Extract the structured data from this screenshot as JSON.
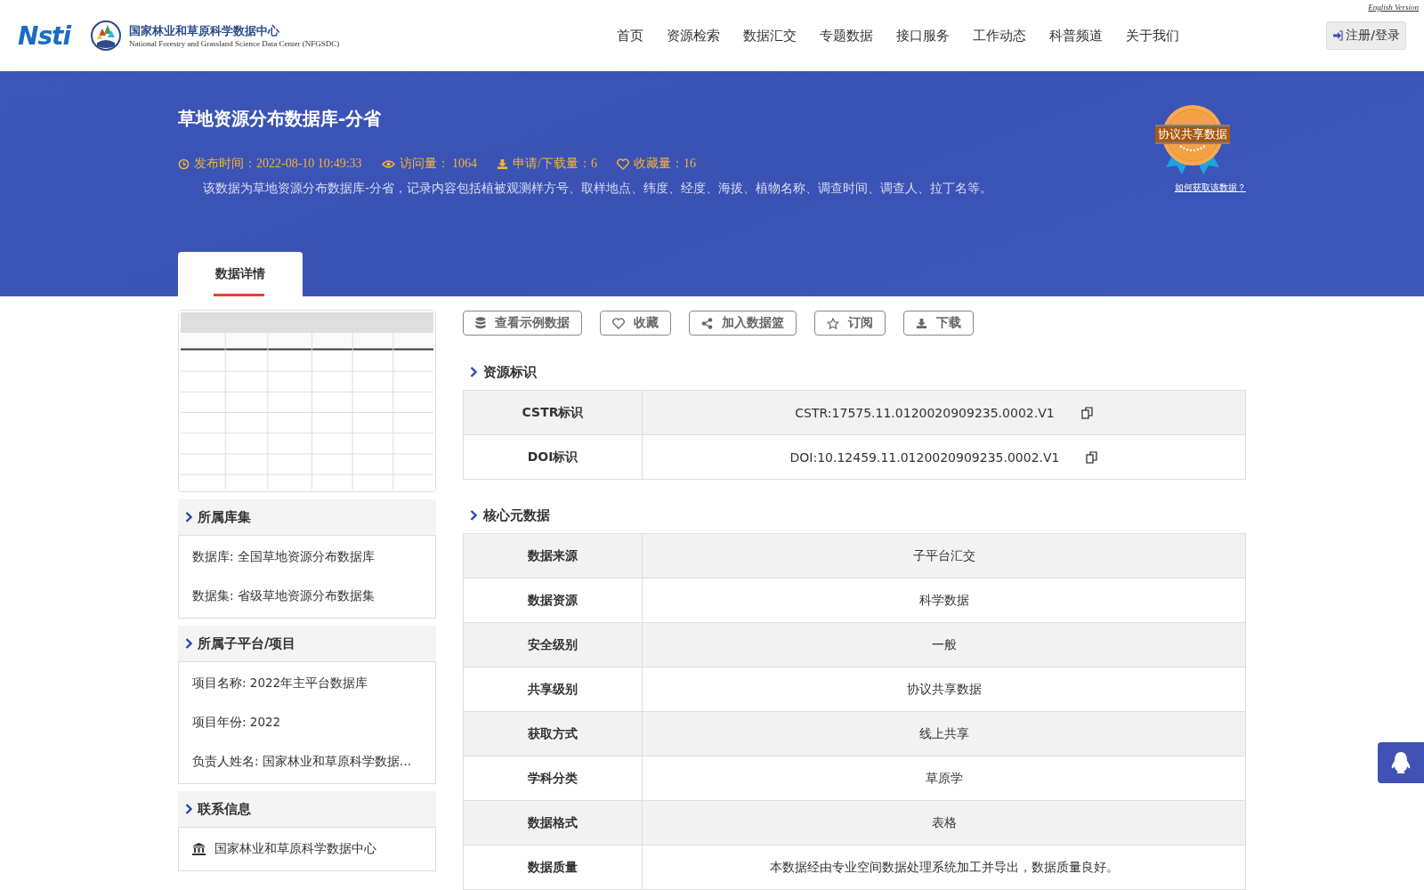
{
  "header": {
    "english_link": "English Version",
    "logo_mark": "Nsti",
    "logo_name": "国家林业和草原科学数据中心",
    "logo_subtitle": "National Forestry and Grassland Science Data Center (NFGSDC)",
    "nav": [
      {
        "label": "首页"
      },
      {
        "label": "资源检索"
      },
      {
        "label": "数据汇交"
      },
      {
        "label": "专题数据"
      },
      {
        "label": "接口服务"
      },
      {
        "label": "工作动态"
      },
      {
        "label": "科普频道"
      },
      {
        "label": "关于我们"
      }
    ],
    "login": "注册/登录"
  },
  "dataset": {
    "title": "草地资源分布数据库-分省",
    "meta": [
      {
        "kind": "time",
        "text": "发布时间：2022-08-10 10:49:33"
      },
      {
        "kind": "views",
        "text": "访问量： 1064"
      },
      {
        "kind": "downloads",
        "text": "申请/下载量：6"
      },
      {
        "kind": "favorites",
        "text": "收藏量：16"
      }
    ],
    "description": "该数据为草地资源分布数据库-分省，记录内容包括植被观测样方号、取样地点、纬度、经度、海拔、植物名称、调查时间、调查人、拉丁名等。",
    "badge": "协议共享数据",
    "badge_link": "如何获取该数据？"
  },
  "tabs": [
    {
      "label": "数据详情",
      "selected": true
    }
  ],
  "side_panels": [
    {
      "title": "所属库集",
      "items": [
        {
          "kind": "text",
          "text": "数据库: 全国草地资源分布数据库"
        },
        {
          "kind": "text",
          "text": "数据集: 省级草地资源分布数据集"
        }
      ]
    },
    {
      "title": "所属子平台/项目",
      "items": [
        {
          "kind": "text",
          "text": "项目名称: 2022年主平台数据库"
        },
        {
          "kind": "text",
          "text": "项目年份: 2022"
        },
        {
          "kind": "text",
          "text": "负责人姓名: 国家林业和草原科学数据…"
        }
      ]
    },
    {
      "title": "联系信息",
      "items": [
        {
          "kind": "org",
          "text": "国家林业和草原科学数据中心"
        }
      ]
    }
  ],
  "actions": [
    {
      "kind": "sample",
      "label": "查看示例数据"
    },
    {
      "kind": "favorite",
      "label": "收藏"
    },
    {
      "kind": "basket",
      "label": "加入数据篮"
    },
    {
      "kind": "subscribe",
      "label": "订阅"
    },
    {
      "kind": "download",
      "label": "下载"
    }
  ],
  "sections": [
    {
      "title": "资源标识",
      "rows": [
        {
          "label": "CSTR标识",
          "value": "CSTR:17575.11.0120020909235.0002.V1",
          "copyable": true
        },
        {
          "label": "DOI标识",
          "value": "DOI:10.12459.11.0120020909235.0002.V1",
          "copyable": true
        }
      ]
    },
    {
      "title": "核心元数据",
      "rows": [
        {
          "label": "数据来源",
          "value": "子平台汇交",
          "copyable": false
        },
        {
          "label": "数据资源",
          "value": "科学数据",
          "copyable": false
        },
        {
          "label": "安全级别",
          "value": "一般",
          "copyable": false
        },
        {
          "label": "共享级别",
          "value": "协议共享数据",
          "copyable": false
        },
        {
          "label": "获取方式",
          "value": "线上共享",
          "copyable": false
        },
        {
          "label": "学科分类",
          "value": "草原学",
          "copyable": false
        },
        {
          "label": "数据格式",
          "value": "表格",
          "copyable": false
        },
        {
          "label": "数据质量",
          "value": "本数据经由专业空间数据处理系统加工并导出，数据质量良好。",
          "copyable": false
        }
      ]
    }
  ]
}
